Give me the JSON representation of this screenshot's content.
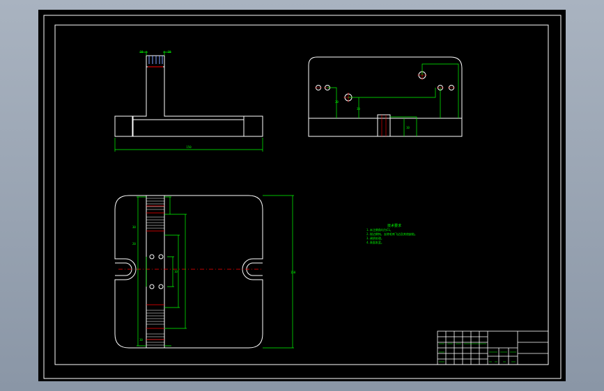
{
  "drawing": {
    "colors": {
      "paper": "#000000",
      "outline": "#ffffff",
      "dimension": "#00ff00",
      "centerline": "#ff0000",
      "background": "#9aa5b3"
    },
    "dimensions": {
      "front_width": "150",
      "front_top_left": "10",
      "front_top_right": "10",
      "plan_height": "150",
      "plan_left_1": "30",
      "plan_left_2": "20",
      "plan_mid": "10",
      "plan_bottom": "10",
      "side_a": "20",
      "side_b": "30",
      "side_c": "10"
    },
    "notes": {
      "title": "技术要求",
      "lines": [
        "1.未注倒角均为C1。",
        "2.锐边倒钝，去除毛刺飞边及其他缺陷。",
        "3.调质处理。",
        "4.表面发蓝。"
      ]
    }
  }
}
